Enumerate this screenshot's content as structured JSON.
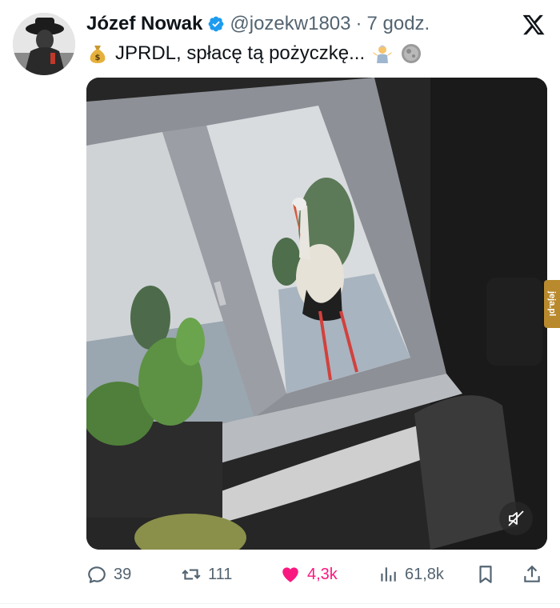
{
  "author": {
    "name": "Józef Nowak",
    "handle": "@jozekw1803",
    "separator": "·",
    "time": "7 godz."
  },
  "tweet": {
    "text": "JPRDL, spłacę tą pożyczkę...",
    "leading_emoji_icon": "money-bag-icon",
    "trailing_emoji_icons": [
      "person-shrugging-icon",
      "coin-icon"
    ]
  },
  "media": {
    "description_icon": "video",
    "mute_icon": "speaker-muted-icon"
  },
  "watermark": {
    "text": "jeja.pl"
  },
  "actions": {
    "replies": "39",
    "reposts": "111",
    "likes": "4,3k",
    "views": "61,8k"
  },
  "colors": {
    "verified": "#1d9bf0",
    "like": "#f91880",
    "muted_text": "#536471",
    "watermark": "#b98a2d"
  }
}
